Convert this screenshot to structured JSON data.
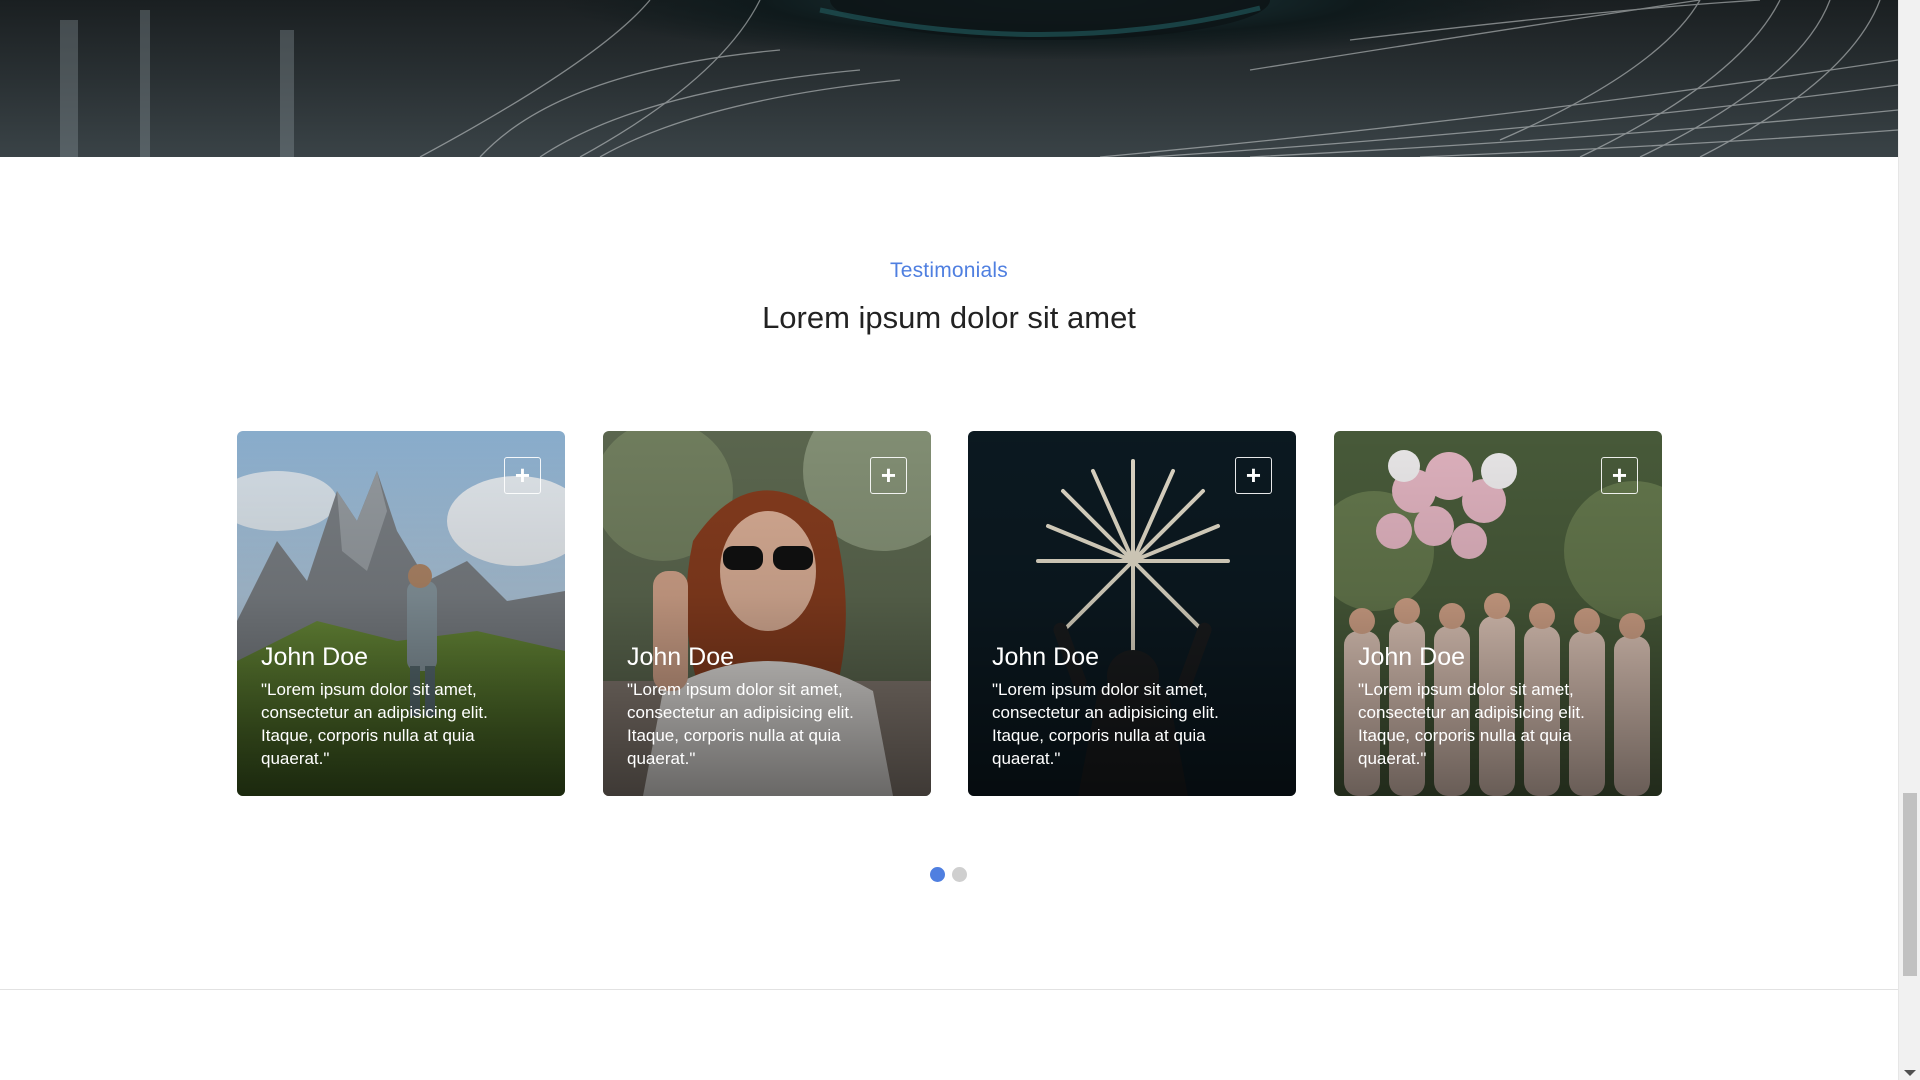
{
  "section": {
    "eyebrow": "Testimonials",
    "title": "Lorem ipsum dolor sit amet"
  },
  "cards": [
    {
      "name": "John Doe",
      "quote": "\"Lorem ipsum dolor sit amet, consectetur an adipisicing elit. Itaque, corporis nulla at quia quaerat.\"",
      "plus_icon": "+"
    },
    {
      "name": "John Doe",
      "quote": "\"Lorem ipsum dolor sit amet, consectetur an adipisicing elit. Itaque, corporis nulla at quia quaerat.\"",
      "plus_icon": "+"
    },
    {
      "name": "John Doe",
      "quote": "\"Lorem ipsum dolor sit amet, consectetur an adipisicing elit. Itaque, corporis nulla at quia quaerat.\"",
      "plus_icon": "+"
    },
    {
      "name": "John Doe",
      "quote": "\"Lorem ipsum dolor sit amet, consectetur an adipisicing elit. Itaque, corporis nulla at quia quaerat.\"",
      "plus_icon": "+"
    }
  ],
  "carousel": {
    "pages": 2,
    "active_page": 1
  },
  "colors": {
    "accent": "#4f7fe0",
    "dot_inactive": "#cfcfcf"
  }
}
